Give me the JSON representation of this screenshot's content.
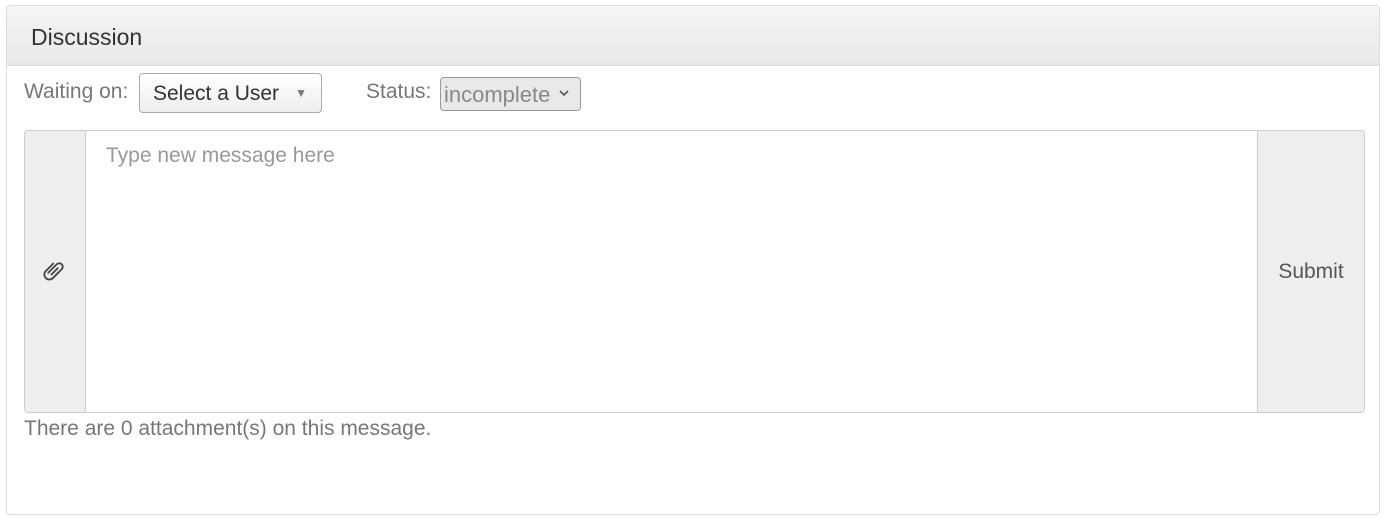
{
  "panel": {
    "title": "Discussion"
  },
  "controls": {
    "waiting_label": "Waiting on:",
    "user_select_value": "Select a User",
    "status_label": "Status:",
    "status_select_value": "incomplete"
  },
  "compose": {
    "attach_icon": "paperclip-icon",
    "message_placeholder": "Type new message here",
    "message_value": "",
    "submit_label": "Submit"
  },
  "attachments": {
    "status_text": "There are 0 attachment(s) on this message."
  }
}
